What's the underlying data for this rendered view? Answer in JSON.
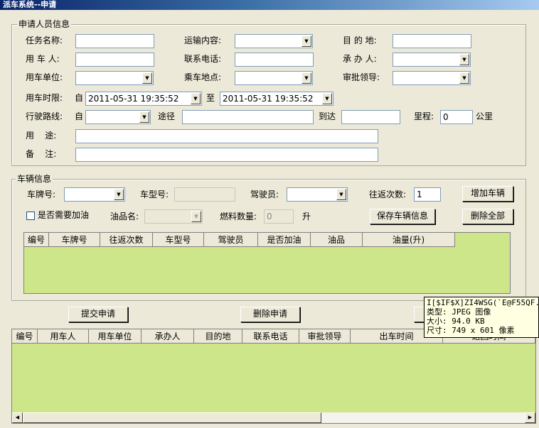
{
  "window": {
    "title": "派车系统--申请"
  },
  "applicant_group": {
    "legend": "申请人员信息",
    "task_name_label": "任务名称:",
    "transport_content_label": "运输内容:",
    "destination_label": "目 的 地:",
    "user_label": "用 车 人:",
    "contact_phone_label": "联系电话:",
    "handler_label": "承 办 人:",
    "unit_label": "用车单位:",
    "boarding_label": "乘车地点:",
    "approver_label": "审批领导:",
    "time_limit_label": "用车时限:",
    "from_label": "自",
    "to_label": "至",
    "start_time": "2011-05-31 19:35:52",
    "end_time": "2011-05-31 19:35:52",
    "route_label": "行驶路线:",
    "route_from_label": "自",
    "via_label": "途径",
    "arrive_label": "到达",
    "mileage_label": "里程:",
    "mileage_value": "0",
    "mileage_unit": "公里",
    "purpose_label": "用    途:",
    "remark_label": "备    注:"
  },
  "vehicle_group": {
    "legend": "车辆信息",
    "plate_label": "车牌号:",
    "model_label": "车型号:",
    "driver_label": "驾驶员:",
    "trips_label": "往返次数:",
    "trips_value": "1",
    "add_vehicle_button": "增加车辆",
    "need_fuel_label": "是否需要加油",
    "fuel_name_label": "油品名:",
    "fuel_amount_label": "燃料数量:",
    "fuel_amount_value": "0",
    "fuel_unit": "升",
    "save_vehicle_button": "保存车辆信息",
    "delete_all_button": "删除全部",
    "columns": [
      "编号",
      "车牌号",
      "往返次数",
      "车型号",
      "驾驶员",
      "是否加油",
      "油品",
      "油量(升)"
    ]
  },
  "actions": {
    "submit_button": "提交申请",
    "delete_button": "删除申请"
  },
  "applications_table": {
    "columns": [
      "编号",
      "用车人",
      "用车单位",
      "承办人",
      "目的地",
      "联系电话",
      "审批领导",
      "出车时间",
      "返回时间"
    ]
  },
  "tooltip": {
    "line1": "I[$IF$X]ZI4WSG(`E@F55QF.jpg",
    "line2": "类型: JPEG 图像",
    "line3": "大小: 94.0 KB",
    "line4": "尺寸: 749 x 601 像素"
  }
}
